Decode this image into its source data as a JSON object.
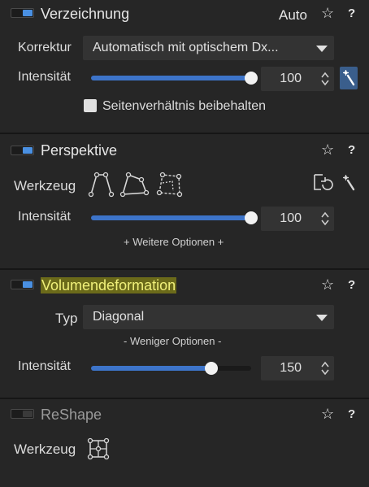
{
  "distortion": {
    "title": "Verzeichnung",
    "auto_label": "Auto",
    "correction_label": "Korrektur",
    "correction_value": "Automatisch mit optischem Dx...",
    "intensity_label": "Intensität",
    "intensity_value": "100",
    "intensity_fraction": 1.0,
    "keep_ratio_label": "Seitenverhältnis beibehalten",
    "keep_ratio_checked": false
  },
  "perspective": {
    "title": "Perspektive",
    "tool_label": "Werkzeug",
    "intensity_label": "Intensität",
    "intensity_value": "100",
    "intensity_fraction": 1.0,
    "more_options": "+ Weitere Optionen +"
  },
  "volume": {
    "title": "Volumendeformation",
    "type_label": "Typ",
    "type_value": "Diagonal",
    "less_options": "- Weniger Optionen -",
    "intensity_label": "Intensität",
    "intensity_value": "150",
    "intensity_fraction": 0.75
  },
  "reshape": {
    "title": "ReShape",
    "tool_label": "Werkzeug"
  },
  "icons": {
    "star": "☆",
    "help": "?"
  },
  "colors": {
    "accent": "#4a90e2",
    "slider_fill": "#3d74c9",
    "highlight": "#f0f07a"
  }
}
